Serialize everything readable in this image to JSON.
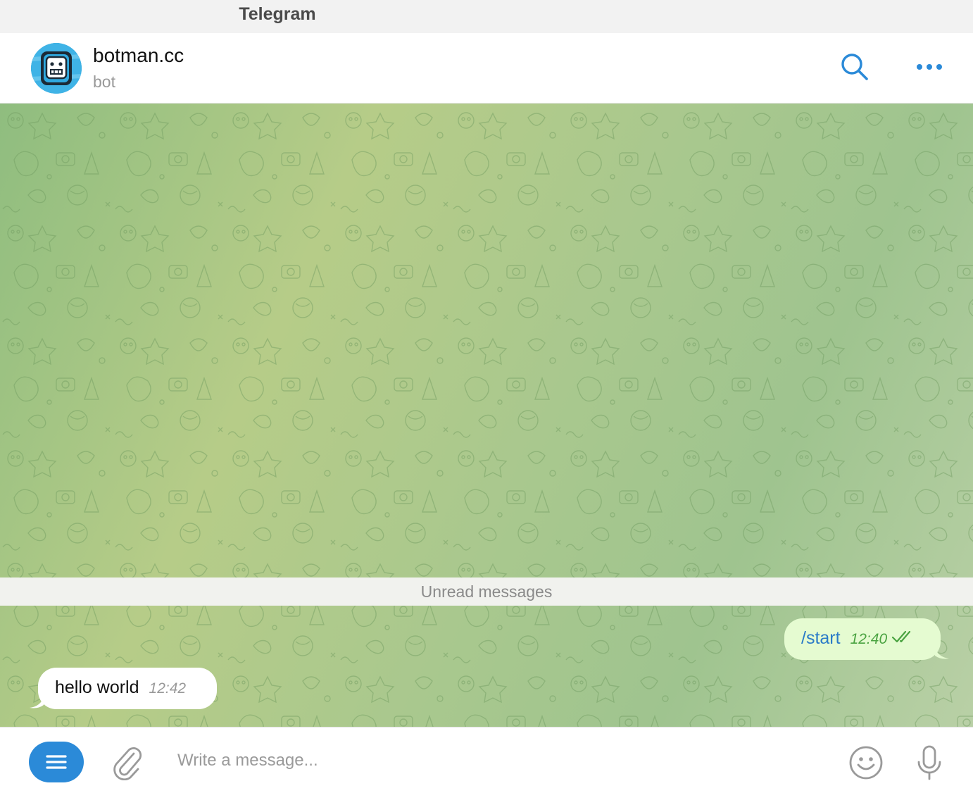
{
  "window": {
    "title": "Telegram"
  },
  "chat_header": {
    "name": "botman.cc",
    "status": "bot",
    "avatar_icon": "robot-avatar-icon"
  },
  "divider": {
    "label": "Unread messages"
  },
  "messages": [
    {
      "direction": "outgoing",
      "text": "/start",
      "time": "12:40",
      "read": true
    },
    {
      "direction": "incoming",
      "text": "hello world",
      "time": "12:42"
    }
  ],
  "composer": {
    "placeholder": "Write a message..."
  },
  "colors": {
    "accent": "#2b8ad8",
    "outgoing_bubble": "#e5fbd1",
    "outgoing_time": "#4aa341",
    "chat_background": "#a9c88e"
  }
}
